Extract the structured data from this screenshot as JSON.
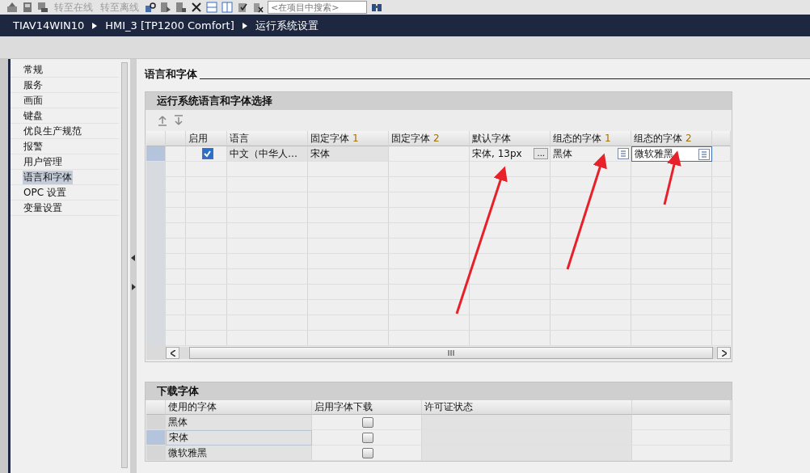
{
  "toolbar": {
    "go_online": {
      "label": "转至在线",
      "disabled": true
    },
    "go_offline": {
      "label": "转至离线",
      "disabled": true
    },
    "search": {
      "placeholder": "<在项目中搜索>"
    }
  },
  "breadcrumb": [
    "TIAV14WIN10",
    "HMI_3 [TP1200 Comfort]",
    "运行系统设置"
  ],
  "nav": {
    "items": [
      {
        "label": "常规",
        "selected": false
      },
      {
        "label": "服务",
        "selected": false
      },
      {
        "label": "画面",
        "selected": false
      },
      {
        "label": "键盘",
        "selected": false
      },
      {
        "label": "优良生产规范",
        "selected": false
      },
      {
        "label": "报警",
        "selected": false
      },
      {
        "label": "用户管理",
        "selected": false
      },
      {
        "label": "语言和字体",
        "selected": true
      },
      {
        "label": "OPC 设置",
        "selected": false
      },
      {
        "label": "变量设置",
        "selected": false
      }
    ]
  },
  "section_title": "语言和字体",
  "language_panel": {
    "title": "运行系统语言和字体选择",
    "columns": [
      {
        "label": "启用"
      },
      {
        "label": "语言"
      },
      {
        "label": "固定字体",
        "index": "1"
      },
      {
        "label": "固定字体",
        "index": "2"
      },
      {
        "label": "默认字体"
      },
      {
        "label": "组态的字体",
        "index": "1"
      },
      {
        "label": "组态的字体",
        "index": "2"
      }
    ],
    "rows": [
      {
        "enabled": true,
        "language": "中文（中华人…",
        "fixed_font_1": "宋体",
        "default_font": "宋体, 13px",
        "default_font_button": "...",
        "config_font_1": "黑体",
        "config_font_2": "微软雅黑",
        "editing": true
      }
    ]
  },
  "download_panel": {
    "title": "下载字体",
    "columns": [
      "使用的字体",
      "启用字体下载",
      "许可证状态"
    ],
    "rows": [
      {
        "font": "黑体",
        "download_enabled": false,
        "selected": false
      },
      {
        "font": "宋体",
        "download_enabled": false,
        "selected": true
      },
      {
        "font": "微软雅黑",
        "download_enabled": false,
        "selected": false
      }
    ]
  }
}
